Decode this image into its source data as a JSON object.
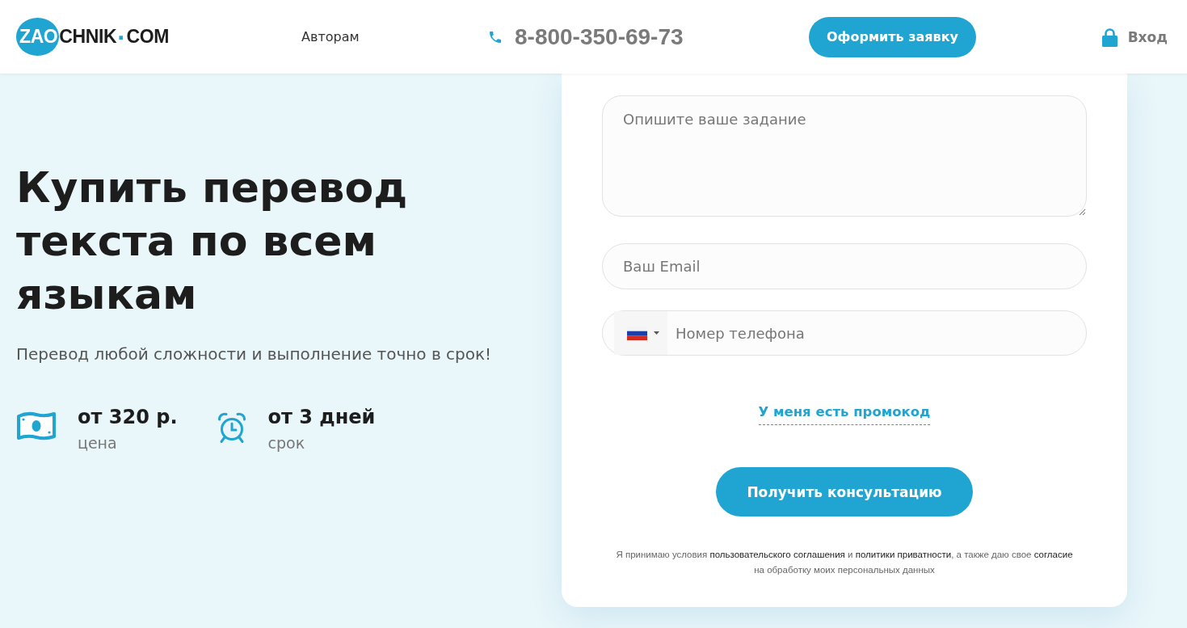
{
  "header": {
    "logo": [
      {
        "kind": "badge",
        "text": "ZAO"
      },
      {
        "kind": "plain",
        "text": "CHNIK"
      },
      {
        "kind": "accent",
        "text": "·"
      },
      {
        "kind": "plain",
        "text": "COM"
      }
    ],
    "nav": [
      {
        "label": "Авторам"
      }
    ],
    "phone": "8-800-350-69-73",
    "cta_button": "Оформить заявку",
    "login": "Вход"
  },
  "hero": {
    "title": "Купить перевод текста по всем языкам",
    "subtitle": "Перевод любой сложности и выполнение точно в срок!",
    "features": [
      {
        "kind": "price",
        "value": "от 320 р.",
        "caption": "цена"
      },
      {
        "kind": "term",
        "value": "от 3 дней",
        "caption": "срок"
      }
    ]
  },
  "form": {
    "task_field": {
      "placeholder": "Опишите ваше задание"
    },
    "email_field": {
      "placeholder": "Ваш Email"
    },
    "phone_field": {
      "placeholder": "Номер телефона"
    },
    "promo_link": "У меня есть промокод",
    "submit_button": "Получить консультацию",
    "consent": [
      {
        "kind": "text",
        "text": "Я принимаю условия "
      },
      {
        "kind": "link",
        "text": "пользовательского соглашения"
      },
      {
        "kind": "text",
        "text": " и  "
      },
      {
        "kind": "link",
        "text": "политики приватности"
      },
      {
        "kind": "text",
        "text": ", а также даю свое "
      },
      {
        "kind": "link",
        "text": "согласие"
      },
      {
        "kind": "text",
        "text": " на обработку моих персональных данных"
      }
    ]
  }
}
